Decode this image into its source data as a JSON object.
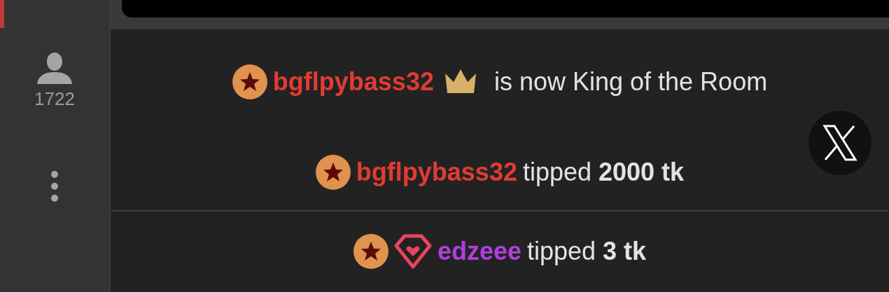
{
  "sidebar": {
    "viewer_count": "1722"
  },
  "messages": [
    {
      "kind": "king",
      "user": "bgflpybass32",
      "color": "#e03c33",
      "badges": [
        {
          "kind": "star"
        }
      ],
      "text": "is now King of the Room"
    },
    {
      "kind": "tip",
      "user": "bgflpybass32",
      "color": "#e03c33",
      "badges": [
        {
          "kind": "star"
        }
      ],
      "verb": "tipped",
      "amount": "2000 tk"
    },
    {
      "kind": "tip",
      "user": "edzeee",
      "color": "#b13ee0",
      "badges": [
        {
          "kind": "star"
        },
        {
          "kind": "gem"
        }
      ],
      "verb": "tipped",
      "amount": "3 tk"
    }
  ]
}
